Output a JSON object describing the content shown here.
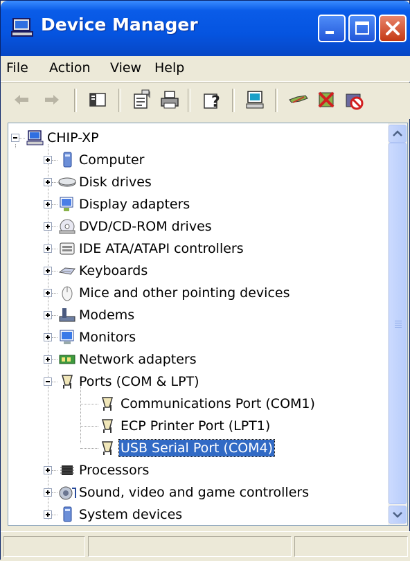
{
  "window": {
    "title": "Device Manager",
    "controls": [
      "minimize-icon",
      "maximize-icon",
      "close-icon"
    ]
  },
  "menu": {
    "items": [
      "File",
      "Action",
      "View",
      "Help"
    ]
  },
  "toolbar": {
    "buttons": [
      {
        "icon": "back-arrow-icon"
      },
      {
        "icon": "forward-arrow-icon"
      },
      {
        "icon": "show-hide-console-tree-icon"
      },
      {
        "icon": "properties-icon"
      },
      {
        "icon": "print-icon"
      },
      {
        "icon": "help-icon"
      },
      {
        "icon": "scan-hardware-changes-icon"
      },
      {
        "icon": "update-driver-icon"
      },
      {
        "icon": "uninstall-icon"
      },
      {
        "icon": "disable-icon"
      }
    ]
  },
  "tree": {
    "root": "CHIP-XP",
    "categories": [
      "Computer",
      "Disk drives",
      "Display adapters",
      "DVD/CD-ROM drives",
      "IDE ATA/ATAPI controllers",
      "Keyboards",
      "Mice and other pointing devices",
      "Modems",
      "Monitors",
      "Network adapters",
      "Ports (COM & LPT)",
      "Processors",
      "Sound, video and game controllers",
      "System devices"
    ],
    "ports_children": [
      "Communications Port (COM1)",
      "ECP Printer Port (LPT1)",
      "USB Serial Port (COM4)"
    ],
    "selected": "USB Serial Port (COM4)"
  },
  "colors": {
    "titlebar": "#0554e0",
    "selection": "#316ac5",
    "window_bg": "#ece9d8"
  }
}
